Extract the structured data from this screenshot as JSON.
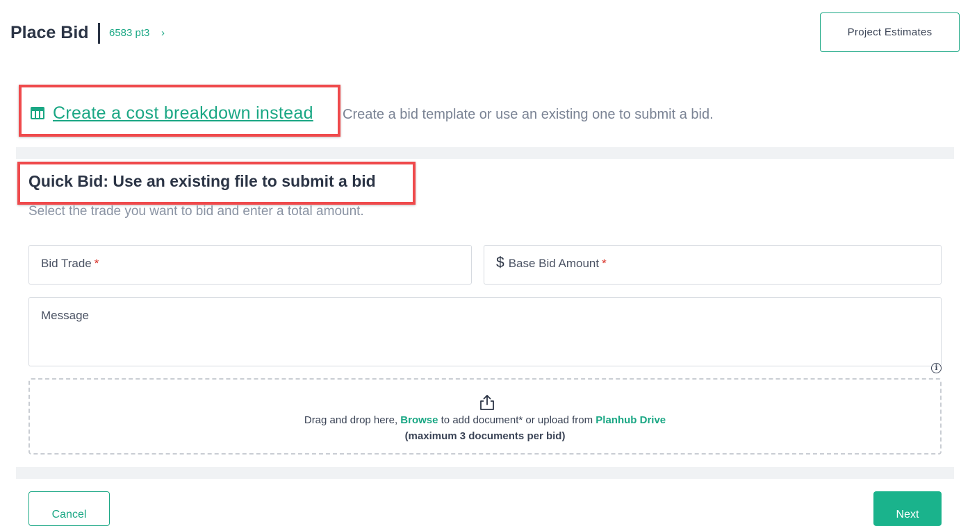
{
  "header": {
    "title": "Place Bid",
    "breadcrumb": "6583 pt3",
    "breadcrumb_chevron": "›",
    "project_estimates_label": "Project Estimates"
  },
  "cost_breakdown": {
    "icon": "table-icon",
    "link_label": "Create a cost breakdown instead",
    "description": "Create a bid template or use an existing one to submit a bid."
  },
  "quick_bid": {
    "title": "Quick Bid: Use an existing file to submit a bid",
    "subtitle": "Select the trade you want to bid and enter a total amount.",
    "bid_trade_label": "Bid Trade",
    "base_bid_currency": "$",
    "base_bid_label": "Base Bid Amount",
    "required_mark": "*",
    "message_label": "Message",
    "info_icon": "i"
  },
  "dropzone": {
    "icon": "upload-icon",
    "text_before": "Drag and drop here, ",
    "browse_label": "Browse",
    "text_middle": " to add document* or upload from ",
    "drive_label": "Planhub Drive",
    "limit_note": "(maximum 3 documents per bid)"
  },
  "footer": {
    "cancel_label": "Cancel",
    "next_label": "Next"
  },
  "colors": {
    "accent": "#1aa784",
    "highlight": "#ef4a4c",
    "required": "#d9342b"
  }
}
